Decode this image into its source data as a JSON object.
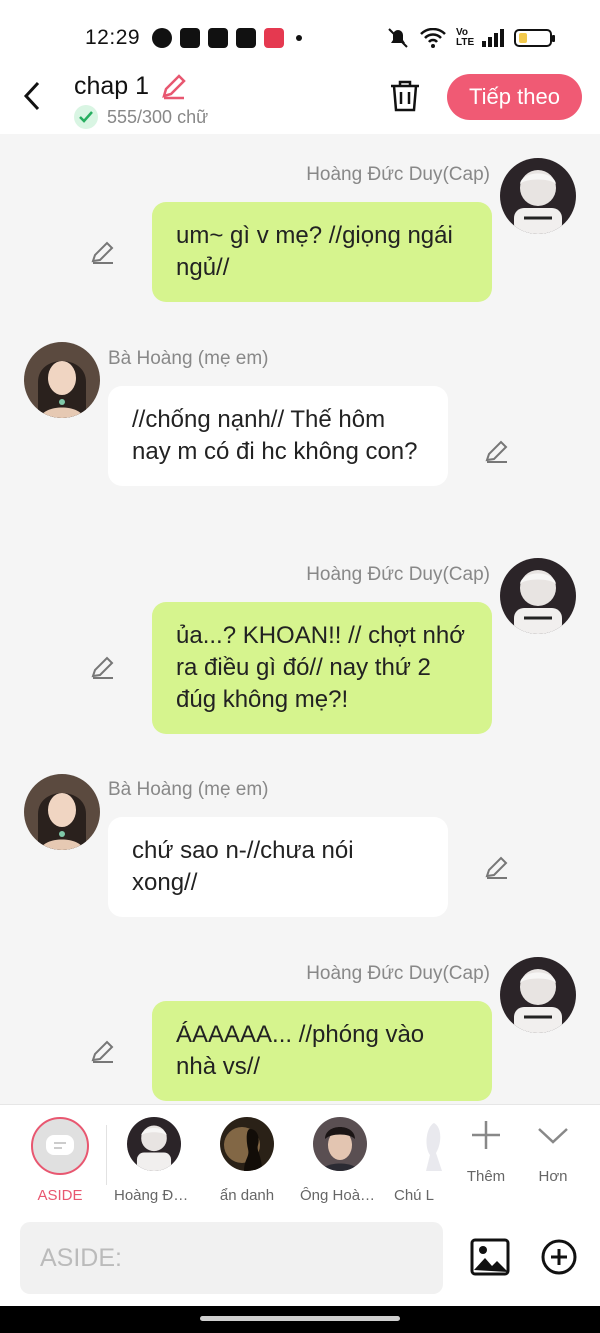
{
  "status_bar": {
    "time": "12:29",
    "network": "Vo LTE"
  },
  "header": {
    "title": "chap 1",
    "word_count": "555/300 chữ",
    "next_button": "Tiếp theo"
  },
  "messages": [
    {
      "speaker": "Hoàng Đức Duy(Cap)",
      "side": "right",
      "text": "um~ gì v mẹ? //giọng ngái ngủ//"
    },
    {
      "speaker": "Bà Hoàng (mẹ em)",
      "side": "left",
      "text": "//chống nạnh// Thế hôm nay m có đi hc không con?"
    },
    {
      "speaker": "Hoàng Đức Duy(Cap)",
      "side": "right",
      "text": "ủa...? KHOAN!! // chợt nhớ ra điều gì đó// nay thứ 2 đúg không mẹ?!"
    },
    {
      "speaker": "Bà Hoàng (mẹ em)",
      "side": "left",
      "text": "chứ sao n-//chưa nói xong//"
    },
    {
      "speaker": "Hoàng Đức Duy(Cap)",
      "side": "right",
      "text": "ÁAAAAA... //phóng vào nhà vs//"
    }
  ],
  "characters": [
    {
      "label": "ASIDE",
      "selected": true
    },
    {
      "label": "Hoàng Đứ..."
    },
    {
      "label": "ẩn danh"
    },
    {
      "label": "Ông Hoàn..."
    },
    {
      "label": "Chú L"
    }
  ],
  "tools": {
    "add_label": "Thêm",
    "more_label": "Hơn"
  },
  "composer": {
    "placeholder": "ASIDE:"
  },
  "colors": {
    "accent": "#f05a74",
    "bubble_self": "#d6f48e",
    "bubble_other": "#ffffff",
    "background": "#f5f5f5"
  }
}
